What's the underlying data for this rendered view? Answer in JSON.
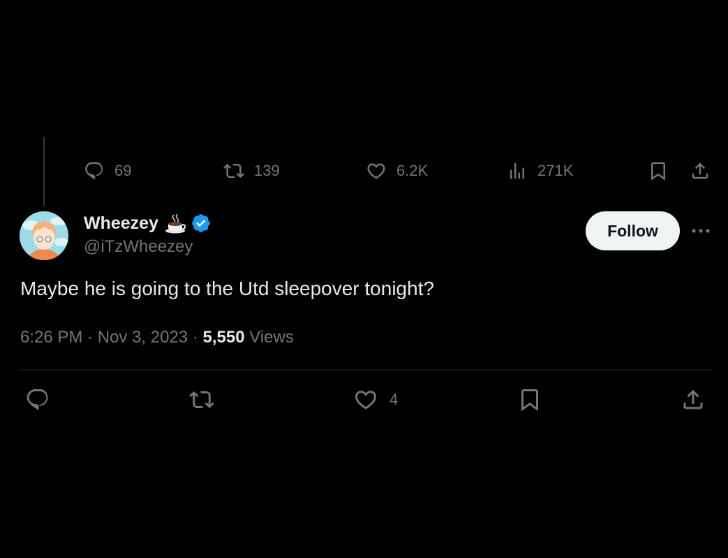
{
  "top_actions": {
    "replies": "69",
    "reposts": "139",
    "likes": "6.2K",
    "views": "271K"
  },
  "tweet": {
    "display_name": "Wheezey",
    "handle": "@iTzWheezey",
    "follow_label": "Follow",
    "text": "Maybe he is going to the Utd sleepover tonight?",
    "time": "6:26 PM",
    "separator": "·",
    "date": "Nov 3, 2023",
    "views_count": "5,550",
    "views_label": "Views"
  },
  "bottom_actions": {
    "likes": "4"
  },
  "colors": {
    "background": "#000000",
    "text": "#e7e9ea",
    "muted": "#71767b",
    "verified": "#1d9bf0",
    "follow_bg": "#eff3f4"
  },
  "icons": {
    "reply": "reply-icon",
    "repost": "repost-icon",
    "like": "heart-icon",
    "views": "analytics-icon",
    "bookmark": "bookmark-icon",
    "share": "share-icon",
    "verified": "verified-badge-icon",
    "emoji": "coffee-emoji-icon",
    "more": "more-icon"
  }
}
